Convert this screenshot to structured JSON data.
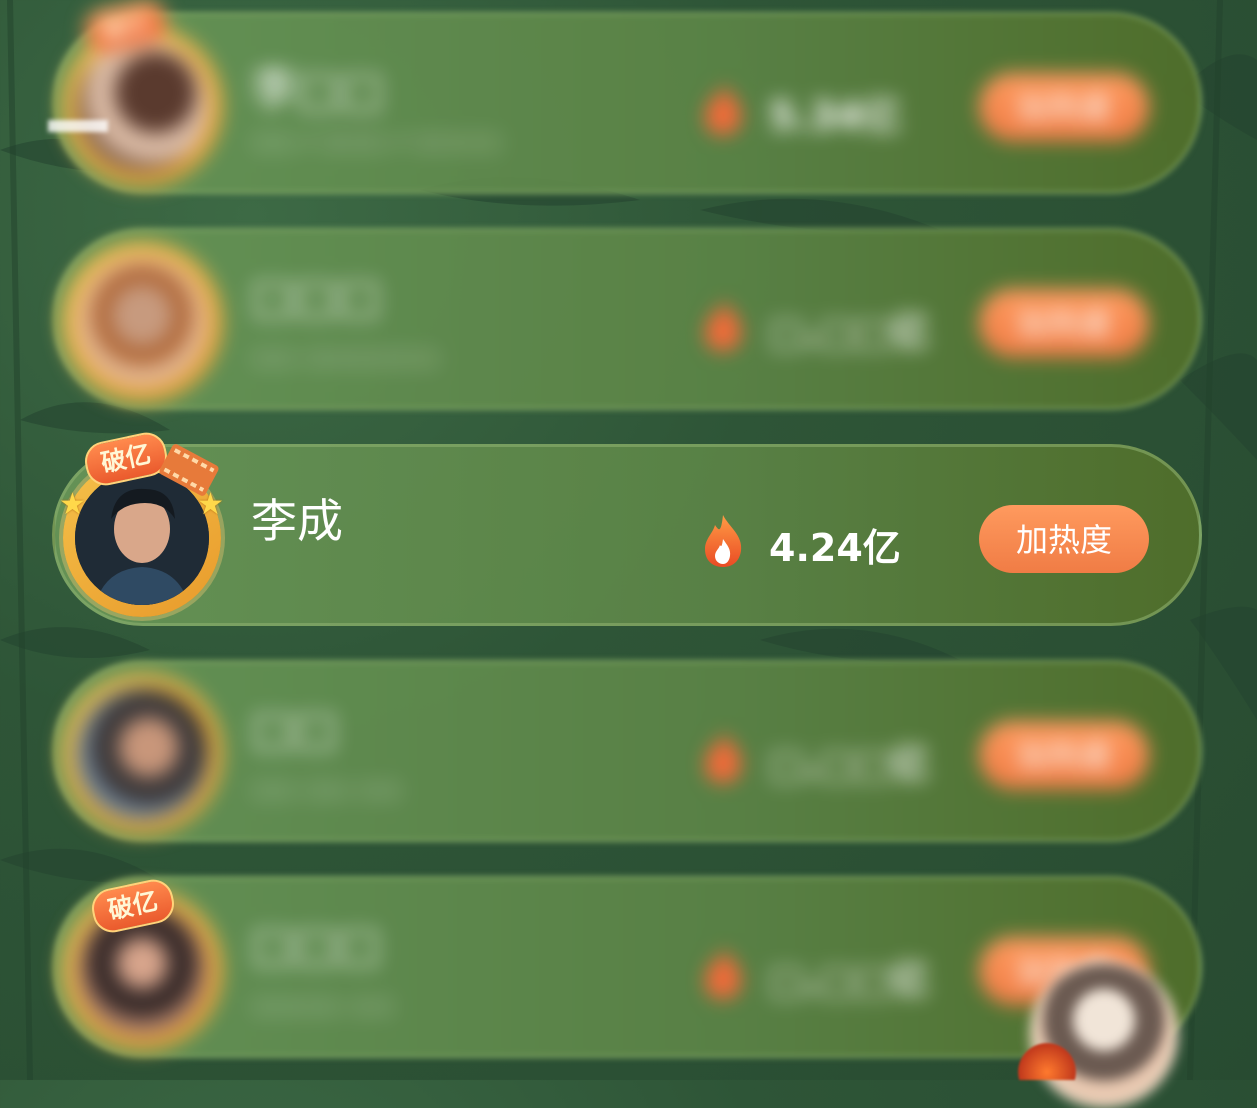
{
  "rows": [
    {
      "name": "李□□",
      "subtitle": "□□ / □□□ / □□□□",
      "heat": "5.34亿",
      "button": "加热度",
      "badge": "破亿",
      "blurred": true
    },
    {
      "name": "□□□",
      "subtitle": "□□ □□□□□□",
      "heat": "□.□□亿",
      "button": "加热度",
      "badge": "",
      "blurred": true
    },
    {
      "name": "李成",
      "subtitle": "",
      "heat": "4.24亿",
      "button": "加热度",
      "badge": "破亿",
      "blurred": false
    },
    {
      "name": "□□",
      "subtitle": "□□ □□ □□",
      "heat": "□.□□亿",
      "button": "加热度",
      "badge": "",
      "blurred": true
    },
    {
      "name": "□□□",
      "subtitle": "□□□□ □□",
      "heat": "□.□□亿",
      "button": "加热度",
      "badge": "破亿",
      "blurred": true
    }
  ],
  "colors": {
    "accent": "#f07c45",
    "badge": "#ea5a2d",
    "card": "#5f8a4c",
    "background": "#2e5537"
  },
  "icons": {
    "fire": "fire-icon",
    "star": "star-icon",
    "film": "film-strip-icon"
  }
}
